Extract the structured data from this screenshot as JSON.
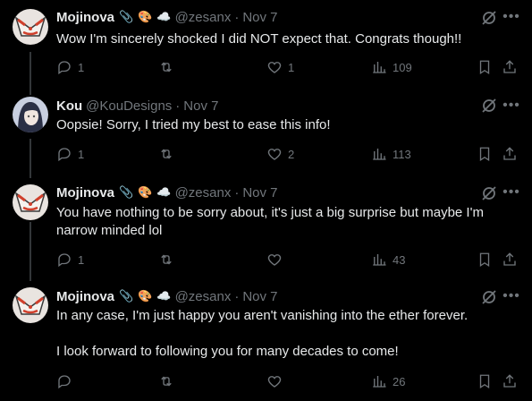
{
  "colors": {
    "background": "#000000",
    "text": "#e7e9ea",
    "muted": "#71767b",
    "thread_line": "#333639"
  },
  "tweets": [
    {
      "name": "Mojinova",
      "badges": [
        "📎",
        "🎨",
        "☁️"
      ],
      "handle": "@zesanx",
      "time": "Nov 7",
      "text": "Wow I'm sincerely shocked I did NOT expect that. Congrats though!!",
      "replies": "1",
      "retweets": "",
      "likes": "1",
      "views": "109",
      "avatar_icon": "mojinova-avatar"
    },
    {
      "name": "Kou",
      "badges": [],
      "handle": "@KouDesigns",
      "time": "Nov 7",
      "text": "Oopsie! Sorry, I tried my best to ease this info!",
      "replies": "1",
      "retweets": "",
      "likes": "2",
      "views": "113",
      "avatar_icon": "kou-avatar"
    },
    {
      "name": "Mojinova",
      "badges": [
        "📎",
        "🎨",
        "☁️"
      ],
      "handle": "@zesanx",
      "time": "Nov 7",
      "text": "You have nothing to be sorry about, it's just a big surprise but maybe I'm narrow minded lol",
      "replies": "1",
      "retweets": "",
      "likes": "",
      "views": "43",
      "avatar_icon": "mojinova-avatar"
    },
    {
      "name": "Mojinova",
      "badges": [
        "📎",
        "🎨",
        "☁️"
      ],
      "handle": "@zesanx",
      "time": "Nov 7",
      "text": "In any case, I'm just happy you aren't vanishing into the ether forever.\n\nI look forward to following you for many decades to come!",
      "replies": "",
      "retweets": "",
      "likes": "",
      "views": "26",
      "avatar_icon": "mojinova-avatar"
    }
  ],
  "separator": "·"
}
